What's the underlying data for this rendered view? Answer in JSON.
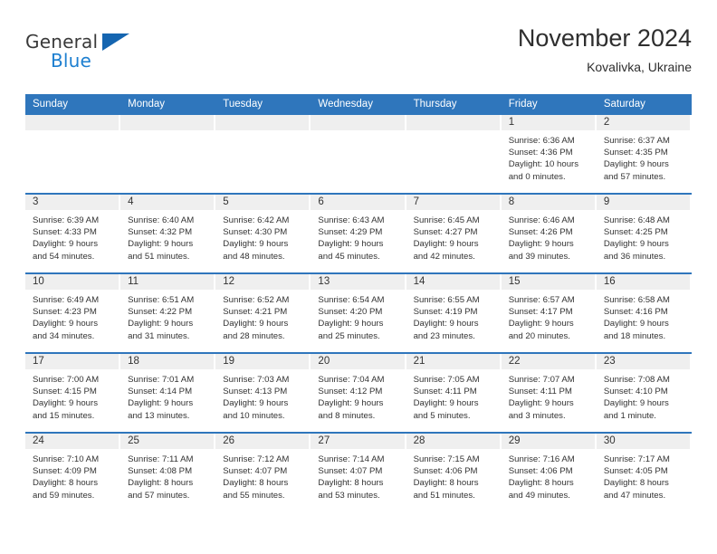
{
  "brand": {
    "name_part1": "General",
    "name_part2": "Blue",
    "triangle_color": "#1565b0",
    "blue_color": "#1d7fd0"
  },
  "header": {
    "month_title": "November 2024",
    "location": "Kovalivka, Ukraine",
    "accent_color": "#2f76bc"
  },
  "calendar": {
    "weekday_headers": [
      "Sunday",
      "Monday",
      "Tuesday",
      "Wednesday",
      "Thursday",
      "Friday",
      "Saturday"
    ],
    "weeks": [
      [
        {
          "day": "",
          "sunrise": "",
          "sunset": "",
          "daylight_line1": "",
          "daylight_line2": ""
        },
        {
          "day": "",
          "sunrise": "",
          "sunset": "",
          "daylight_line1": "",
          "daylight_line2": ""
        },
        {
          "day": "",
          "sunrise": "",
          "sunset": "",
          "daylight_line1": "",
          "daylight_line2": ""
        },
        {
          "day": "",
          "sunrise": "",
          "sunset": "",
          "daylight_line1": "",
          "daylight_line2": ""
        },
        {
          "day": "",
          "sunrise": "",
          "sunset": "",
          "daylight_line1": "",
          "daylight_line2": ""
        },
        {
          "day": "1",
          "sunrise": "Sunrise: 6:36 AM",
          "sunset": "Sunset: 4:36 PM",
          "daylight_line1": "Daylight: 10 hours",
          "daylight_line2": "and 0 minutes."
        },
        {
          "day": "2",
          "sunrise": "Sunrise: 6:37 AM",
          "sunset": "Sunset: 4:35 PM",
          "daylight_line1": "Daylight: 9 hours",
          "daylight_line2": "and 57 minutes."
        }
      ],
      [
        {
          "day": "3",
          "sunrise": "Sunrise: 6:39 AM",
          "sunset": "Sunset: 4:33 PM",
          "daylight_line1": "Daylight: 9 hours",
          "daylight_line2": "and 54 minutes."
        },
        {
          "day": "4",
          "sunrise": "Sunrise: 6:40 AM",
          "sunset": "Sunset: 4:32 PM",
          "daylight_line1": "Daylight: 9 hours",
          "daylight_line2": "and 51 minutes."
        },
        {
          "day": "5",
          "sunrise": "Sunrise: 6:42 AM",
          "sunset": "Sunset: 4:30 PM",
          "daylight_line1": "Daylight: 9 hours",
          "daylight_line2": "and 48 minutes."
        },
        {
          "day": "6",
          "sunrise": "Sunrise: 6:43 AM",
          "sunset": "Sunset: 4:29 PM",
          "daylight_line1": "Daylight: 9 hours",
          "daylight_line2": "and 45 minutes."
        },
        {
          "day": "7",
          "sunrise": "Sunrise: 6:45 AM",
          "sunset": "Sunset: 4:27 PM",
          "daylight_line1": "Daylight: 9 hours",
          "daylight_line2": "and 42 minutes."
        },
        {
          "day": "8",
          "sunrise": "Sunrise: 6:46 AM",
          "sunset": "Sunset: 4:26 PM",
          "daylight_line1": "Daylight: 9 hours",
          "daylight_line2": "and 39 minutes."
        },
        {
          "day": "9",
          "sunrise": "Sunrise: 6:48 AM",
          "sunset": "Sunset: 4:25 PM",
          "daylight_line1": "Daylight: 9 hours",
          "daylight_line2": "and 36 minutes."
        }
      ],
      [
        {
          "day": "10",
          "sunrise": "Sunrise: 6:49 AM",
          "sunset": "Sunset: 4:23 PM",
          "daylight_line1": "Daylight: 9 hours",
          "daylight_line2": "and 34 minutes."
        },
        {
          "day": "11",
          "sunrise": "Sunrise: 6:51 AM",
          "sunset": "Sunset: 4:22 PM",
          "daylight_line1": "Daylight: 9 hours",
          "daylight_line2": "and 31 minutes."
        },
        {
          "day": "12",
          "sunrise": "Sunrise: 6:52 AM",
          "sunset": "Sunset: 4:21 PM",
          "daylight_line1": "Daylight: 9 hours",
          "daylight_line2": "and 28 minutes."
        },
        {
          "day": "13",
          "sunrise": "Sunrise: 6:54 AM",
          "sunset": "Sunset: 4:20 PM",
          "daylight_line1": "Daylight: 9 hours",
          "daylight_line2": "and 25 minutes."
        },
        {
          "day": "14",
          "sunrise": "Sunrise: 6:55 AM",
          "sunset": "Sunset: 4:19 PM",
          "daylight_line1": "Daylight: 9 hours",
          "daylight_line2": "and 23 minutes."
        },
        {
          "day": "15",
          "sunrise": "Sunrise: 6:57 AM",
          "sunset": "Sunset: 4:17 PM",
          "daylight_line1": "Daylight: 9 hours",
          "daylight_line2": "and 20 minutes."
        },
        {
          "day": "16",
          "sunrise": "Sunrise: 6:58 AM",
          "sunset": "Sunset: 4:16 PM",
          "daylight_line1": "Daylight: 9 hours",
          "daylight_line2": "and 18 minutes."
        }
      ],
      [
        {
          "day": "17",
          "sunrise": "Sunrise: 7:00 AM",
          "sunset": "Sunset: 4:15 PM",
          "daylight_line1": "Daylight: 9 hours",
          "daylight_line2": "and 15 minutes."
        },
        {
          "day": "18",
          "sunrise": "Sunrise: 7:01 AM",
          "sunset": "Sunset: 4:14 PM",
          "daylight_line1": "Daylight: 9 hours",
          "daylight_line2": "and 13 minutes."
        },
        {
          "day": "19",
          "sunrise": "Sunrise: 7:03 AM",
          "sunset": "Sunset: 4:13 PM",
          "daylight_line1": "Daylight: 9 hours",
          "daylight_line2": "and 10 minutes."
        },
        {
          "day": "20",
          "sunrise": "Sunrise: 7:04 AM",
          "sunset": "Sunset: 4:12 PM",
          "daylight_line1": "Daylight: 9 hours",
          "daylight_line2": "and 8 minutes."
        },
        {
          "day": "21",
          "sunrise": "Sunrise: 7:05 AM",
          "sunset": "Sunset: 4:11 PM",
          "daylight_line1": "Daylight: 9 hours",
          "daylight_line2": "and 5 minutes."
        },
        {
          "day": "22",
          "sunrise": "Sunrise: 7:07 AM",
          "sunset": "Sunset: 4:11 PM",
          "daylight_line1": "Daylight: 9 hours",
          "daylight_line2": "and 3 minutes."
        },
        {
          "day": "23",
          "sunrise": "Sunrise: 7:08 AM",
          "sunset": "Sunset: 4:10 PM",
          "daylight_line1": "Daylight: 9 hours",
          "daylight_line2": "and 1 minute."
        }
      ],
      [
        {
          "day": "24",
          "sunrise": "Sunrise: 7:10 AM",
          "sunset": "Sunset: 4:09 PM",
          "daylight_line1": "Daylight: 8 hours",
          "daylight_line2": "and 59 minutes."
        },
        {
          "day": "25",
          "sunrise": "Sunrise: 7:11 AM",
          "sunset": "Sunset: 4:08 PM",
          "daylight_line1": "Daylight: 8 hours",
          "daylight_line2": "and 57 minutes."
        },
        {
          "day": "26",
          "sunrise": "Sunrise: 7:12 AM",
          "sunset": "Sunset: 4:07 PM",
          "daylight_line1": "Daylight: 8 hours",
          "daylight_line2": "and 55 minutes."
        },
        {
          "day": "27",
          "sunrise": "Sunrise: 7:14 AM",
          "sunset": "Sunset: 4:07 PM",
          "daylight_line1": "Daylight: 8 hours",
          "daylight_line2": "and 53 minutes."
        },
        {
          "day": "28",
          "sunrise": "Sunrise: 7:15 AM",
          "sunset": "Sunset: 4:06 PM",
          "daylight_line1": "Daylight: 8 hours",
          "daylight_line2": "and 51 minutes."
        },
        {
          "day": "29",
          "sunrise": "Sunrise: 7:16 AM",
          "sunset": "Sunset: 4:06 PM",
          "daylight_line1": "Daylight: 8 hours",
          "daylight_line2": "and 49 minutes."
        },
        {
          "day": "30",
          "sunrise": "Sunrise: 7:17 AM",
          "sunset": "Sunset: 4:05 PM",
          "daylight_line1": "Daylight: 8 hours",
          "daylight_line2": "and 47 minutes."
        }
      ]
    ]
  }
}
